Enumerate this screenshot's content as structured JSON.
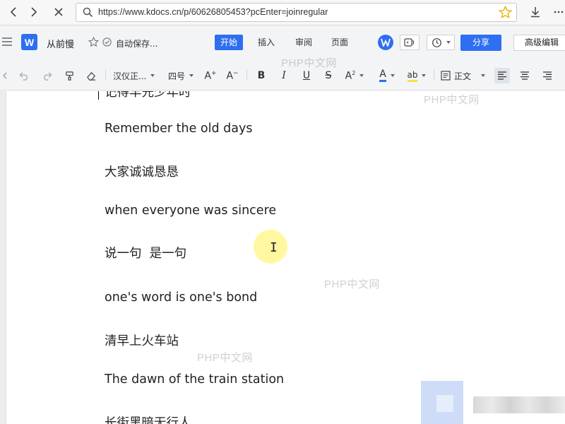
{
  "browser": {
    "url": "https://www.kdocs.cn/p/60626805453?pcEnter=joinregular"
  },
  "header": {
    "logo_letter": "W",
    "doc_title": "从前慢",
    "autosave": "自动保存...",
    "tabs": [
      {
        "label": "开始",
        "active": true
      },
      {
        "label": "插入",
        "active": false
      },
      {
        "label": "审阅",
        "active": false
      },
      {
        "label": "页面",
        "active": false
      }
    ],
    "share_label": "分享",
    "advanced_edit_label": "高级编辑"
  },
  "toolbar": {
    "font_name": "汉仪正...",
    "font_size": "四号",
    "bold": "B",
    "italic": "I",
    "underline": "U",
    "strike": "S",
    "font_color_glyph": "A",
    "font_color": "#2e6ff2",
    "highlight_glyph": "ab",
    "highlight_color": "#f5e14a",
    "style_name": "正文"
  },
  "document": {
    "lines": [
      "Remember the old days",
      "大家诚诚恳恳",
      "when everyone was sincere",
      "说一句  是一句",
      "one's word is one's bond",
      "清早上火车站",
      "The dawn of the train station",
      "长街黑暗无行人"
    ],
    "top_cut_line": "记得早先少年时"
  },
  "watermarks": [
    "PHP中文网",
    "PHP中文网",
    "PHP中文网",
    "PHP中文网"
  ],
  "colors": {
    "accent": "#2e6ff2",
    "background": "#f3f4f6",
    "page": "#ffffff"
  }
}
